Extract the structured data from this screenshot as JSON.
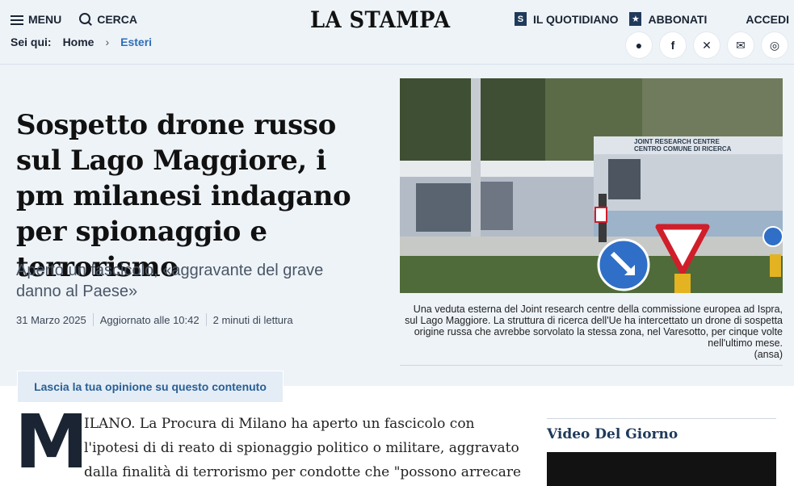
{
  "header": {
    "menu_label": "MENU",
    "search_label": "CERCA",
    "logo": "LA STAMPA",
    "quotidiano_label": "IL QUOTIDIANO",
    "abbonati_label": "ABBONATI",
    "accedi_label": "ACCEDI"
  },
  "breadcrumb": {
    "prefix": "Sei qui:",
    "home": "Home",
    "section": "Esteri"
  },
  "article": {
    "headline": "Sospetto drone russo sul Lago Maggiore, i pm milanesi indagano per spionaggio e terrorismo",
    "subheadline": "Aperto un fascicolo, «aggravante del grave danno al Paese»",
    "date": "31 Marzo 2025",
    "updated": "Aggiornato alle 10:42",
    "reading_time": "2 minuti di lettura",
    "image_caption": "Una veduta esterna del Joint research centre della commissione europea ad Ispra, sul Lago Maggiore. La struttura di ricerca dell'Ue ha intercettato un drone di sospetta origine russa che avrebbe sorvolato la stessa zona, nel Varesotto, per cinque volte nell'ultimo mese.",
    "image_credit": "(ansa)",
    "photo_sign_line1": "JOINT RESEARCH CENTRE",
    "photo_sign_line2": "CENTRO COMUNE DI RICERCA",
    "opinion_label": "Lascia la tua opinione su questo contenuto",
    "dropcap": "M",
    "body": "ILANO. La Procura di Milano ha aperto un fascicolo con l'ipotesi di di reato di spionaggio politico o militare, aggravato dalla finalità di terrorismo per condotte che \"possono arrecare grave"
  },
  "sidebar": {
    "video_title": "Video Del Giorno"
  },
  "icons": {
    "share": [
      "comment-icon",
      "facebook-icon",
      "x-icon",
      "email-icon",
      "whatsapp-icon"
    ]
  }
}
